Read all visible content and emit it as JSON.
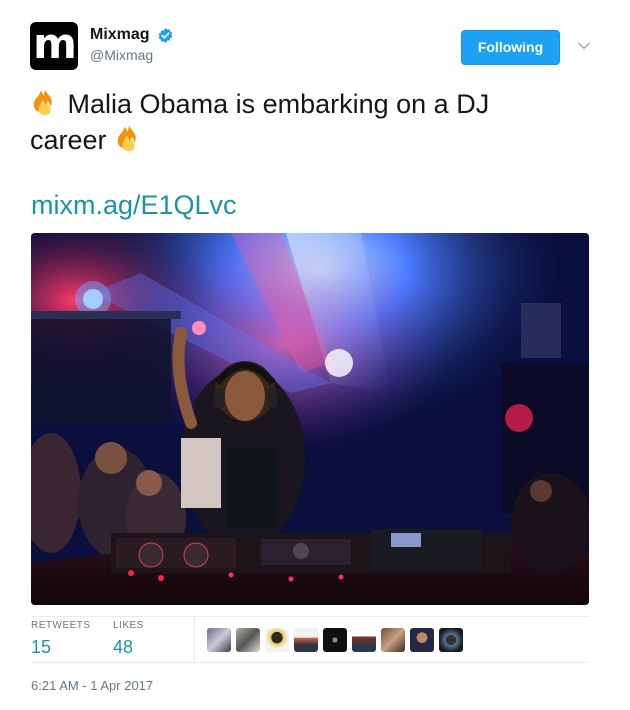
{
  "author": {
    "display_name": "Mixmag",
    "handle": "@Mixmag",
    "avatar_letter": "m",
    "verified": true
  },
  "follow_button": {
    "label": "Following"
  },
  "tweet": {
    "text_line": "Malia Obama is embarking on a DJ",
    "text_line2": "career",
    "link": "mixm.ag/E1QLvc",
    "emoji_icon": "fire-icon"
  },
  "stats": {
    "retweets_label": "RETWEETS",
    "retweets_value": "15",
    "likes_label": "LIKES",
    "likes_value": "48"
  },
  "likers_count_shown": 9,
  "timestamp": "6:21 AM - 1 Apr 2017",
  "colors": {
    "brand_blue": "#1da1f2",
    "link_teal": "#1c94a5",
    "muted_gray": "#657786",
    "divider": "#e6ecf0"
  }
}
